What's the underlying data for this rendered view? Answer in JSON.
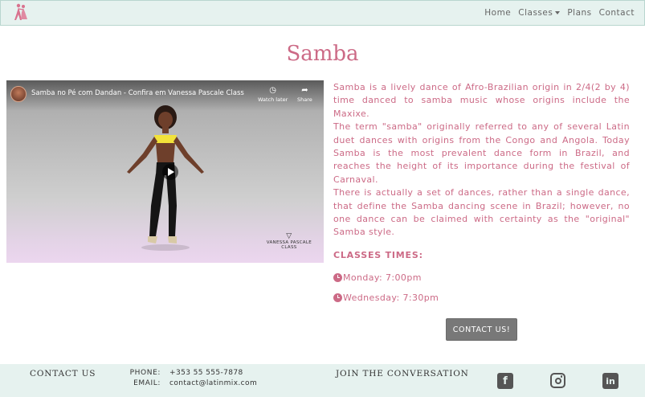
{
  "nav": {
    "logo_icon": "dancing-couple-logo",
    "links": [
      "Home",
      "Classes",
      "Plans",
      "Contact"
    ]
  },
  "page": {
    "title": "Samba"
  },
  "video": {
    "title": "Samba no Pé com Dandan - Confira em Vanessa Pascale Class",
    "watch_later": "Watch later",
    "share": "Share",
    "watermark_line1": "VANESSA PASCALE",
    "watermark_line2": "CLASS"
  },
  "description": {
    "paragraphs": [
      "Samba is a lively dance of Afro-Brazilian origin in 2/4(2 by 4) time danced to samba music whose origins include the Maxixe.",
      "The term \"samba\" originally referred to any of several Latin duet dances with origins from the Congo and Angola. Today Samba is the most prevalent dance form in Brazil, and reaches the height of its importance during the festival of Carnaval.",
      "There is actually a set of dances, rather than a single dance, that define the Samba dancing scene in Brazil; however, no one dance can be claimed with certainty as the \"original\" Samba style."
    ]
  },
  "classes": {
    "heading": "CLASSES TIMES:",
    "times": [
      "Monday: 7:00pm",
      "Wednesday: 7:30pm"
    ]
  },
  "contact_button": "CONTACT US!",
  "footer": {
    "contact_heading": "CONTACT US",
    "phone_label": "PHONE:",
    "phone_value": "+353 55 555-7878",
    "email_label": "EMAIL:",
    "email_value": "contact@latinmix.com",
    "join_heading": "JOIN THE CONVERSATION",
    "social_icons": [
      "facebook-icon",
      "instagram-icon",
      "linkedin-icon"
    ]
  },
  "colors": {
    "accent": "#cc6a86",
    "nav_bg": "#e6f2ef",
    "button_bg": "#787878"
  }
}
